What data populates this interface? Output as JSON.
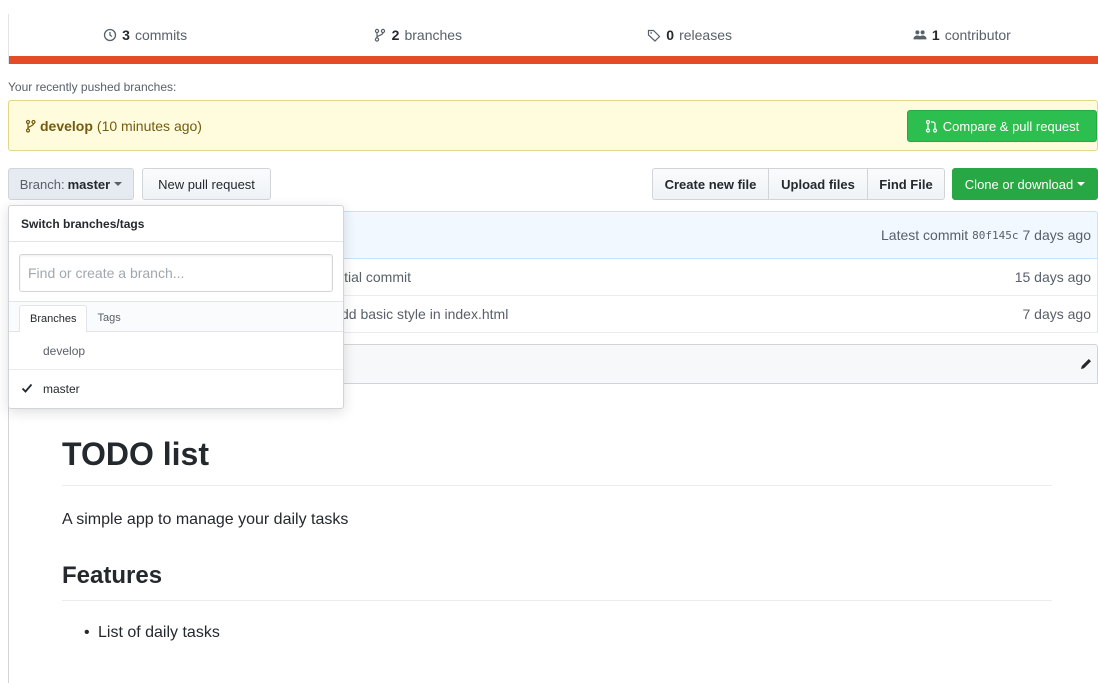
{
  "summary": {
    "commits_count": "3",
    "commits_label": "commits",
    "branches_count": "2",
    "branches_label": "branches",
    "releases_count": "0",
    "releases_label": "releases",
    "contributors_count": "1",
    "contributors_label": "contributor",
    "language_color": "#e34c26"
  },
  "recent": {
    "label": "Your recently pushed branches:",
    "branch_name": "develop",
    "branch_time": "(10 minutes ago)",
    "compare_button": "Compare & pull request"
  },
  "toolbar": {
    "branch_prefix": "Branch:",
    "branch_name": "master",
    "new_pull_request": "New pull request",
    "create_new_file": "Create new file",
    "upload_files": "Upload files",
    "find_file": "Find File",
    "clone_or_download": "Clone or download"
  },
  "commit": {
    "latest_label": "Latest commit",
    "sha": "80f145c",
    "age": "7 days ago"
  },
  "files": [
    {
      "message": "itial commit",
      "age": "15 days ago"
    },
    {
      "message": "dd basic style in index.html",
      "age": "7 days ago"
    }
  ],
  "readme": {
    "h1": "TODO list",
    "paragraph": "A simple app to manage your daily tasks",
    "h2": "Features",
    "list_items": [
      "List of daily tasks"
    ]
  },
  "dropdown": {
    "title": "Switch branches/tags",
    "filter_placeholder": "Find or create a branch...",
    "tabs": [
      "Branches",
      "Tags"
    ],
    "active_tab": "Branches",
    "branches": [
      {
        "name": "develop",
        "selected": false
      },
      {
        "name": "master",
        "selected": true
      }
    ]
  },
  "colors": {
    "green": "#28a745",
    "recent_bg": "#fffbdd",
    "commit_bg": "#f1f8ff"
  }
}
